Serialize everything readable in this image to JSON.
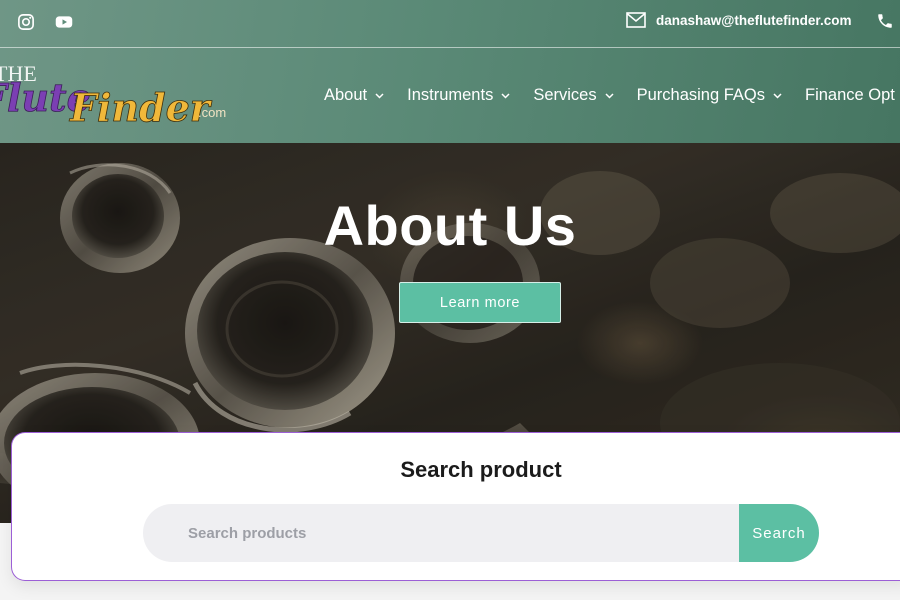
{
  "header": {
    "social": [
      "instagram-icon",
      "youtube-icon"
    ],
    "email": "danashaw@theflutefinder.com",
    "logo": {
      "the": "THE",
      "flute": "Flute",
      "finder": "Finder",
      "domain": ".com"
    },
    "nav": [
      {
        "label": "About",
        "icon": "chevron-down-icon"
      },
      {
        "label": "Instruments",
        "icon": "chevron-down-icon"
      },
      {
        "label": "Services",
        "icon": "chevron-down-icon"
      },
      {
        "label": "Purchasing FAQs",
        "icon": "chevron-down-icon"
      },
      {
        "label": "Finance Opt"
      }
    ]
  },
  "hero": {
    "title": "About Us",
    "button_label": "Learn more"
  },
  "search": {
    "title": "Search product",
    "placeholder": "Search products",
    "value": "",
    "button_label": "Search"
  },
  "colors": {
    "header_start": "#6f9686",
    "header_end": "#467662",
    "accent": "#5cbfa3",
    "card_border": "#9c5fd6",
    "logo_purple": "#7b3fb3",
    "logo_gold": "#f0b83a"
  }
}
